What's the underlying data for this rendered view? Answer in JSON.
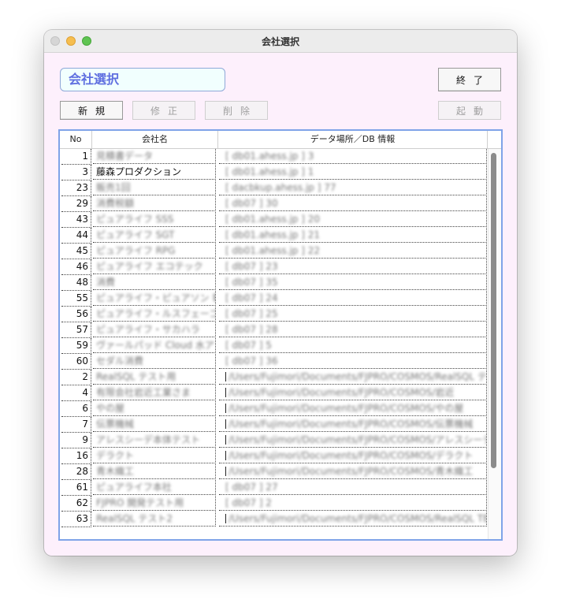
{
  "window": {
    "title": "会社選択"
  },
  "company_field": {
    "value": "会社選択"
  },
  "buttons": {
    "end": "終了",
    "new": "新規",
    "edit": "修正",
    "delete": "削除",
    "launch": "起動"
  },
  "table": {
    "headers": {
      "no": "No",
      "name": "会社名",
      "location": "データ場所／DB 情報"
    },
    "rows": [
      {
        "no": "1",
        "name": "見積書データ",
        "location": "[ db01.ahess.jp ] 3"
      },
      {
        "no": "3",
        "name": "藤森プロダクション",
        "location": "[ db01.ahess.jp ] 1"
      },
      {
        "no": "23",
        "name": "販売1回",
        "location": "[ dacbkup.ahess.jp ] 77"
      },
      {
        "no": "29",
        "name": "消費税額",
        "location": "[ db07 ] 30"
      },
      {
        "no": "43",
        "name": "ピュアライフ SSS",
        "location": "[ db01.ahess.jp ] 20"
      },
      {
        "no": "44",
        "name": "ピュアライフ SGT",
        "location": "[ db01.ahess.jp ] 21"
      },
      {
        "no": "45",
        "name": "ピュアライフ RPG",
        "location": "[ db01.ahess.jp ] 22"
      },
      {
        "no": "46",
        "name": "ピュアライフ エコテック",
        "location": "[ db07 ] 23"
      },
      {
        "no": "48",
        "name": "消費",
        "location": "[ db07 ] 35"
      },
      {
        "no": "55",
        "name": "ピュアライフ・ピュアソン 執",
        "location": "[ db07 ] 24"
      },
      {
        "no": "56",
        "name": "ピュアライフ・ルスフェーゴ",
        "location": "[ db07 ] 25"
      },
      {
        "no": "57",
        "name": "ピュアライフ・サカハラ",
        "location": "[ db07 ] 28"
      },
      {
        "no": "59",
        "name": "ヴァールパッド Cloud 水ア",
        "location": "[ db07 ] 5"
      },
      {
        "no": "60",
        "name": "セダル消費",
        "location": "[ db07 ] 36"
      },
      {
        "no": "2",
        "name": "RealSQL テスト用",
        "location": "/Users/Fujimori/Documents/FJPRO/COSMOS/RealSQL テスト"
      },
      {
        "no": "4",
        "name": "有限会社岩近工業さま",
        "location": "/Users/Fujimori/Documents/FJPRO/COSMOS/岩近"
      },
      {
        "no": "6",
        "name": "やの屋",
        "location": "/Users/Fujimori/Documents/FJPRO/COSMOS/やの屋"
      },
      {
        "no": "7",
        "name": "伝票機械",
        "location": "/Users/Fujimori/Documents/FJPRO/COSMOS/伝票機械"
      },
      {
        "no": "9",
        "name": "アレスシーデ本体テスト",
        "location": "/Users/Fujimori/Documents/FJPRO/COSMOS/アレスシーデ"
      },
      {
        "no": "16",
        "name": "デラクト",
        "location": "/Users/Fujimori/Documents/FJPRO/COSMOS/デラクト"
      },
      {
        "no": "28",
        "name": "青木織工",
        "location": "/Users/Fujimori/Documents/FJPRO/COSMOS/青木織工"
      },
      {
        "no": "61",
        "name": "ピュアライフ本社",
        "location": "[ db07 ] 27"
      },
      {
        "no": "62",
        "name": "FJPRO 開発テスト用",
        "location": "[ db07 ] 2"
      },
      {
        "no": "63",
        "name": "RealSQL テスト2",
        "location": "/Users/Fujimori/Documents/FJPRO/COSMOS/RealSQL TEST"
      }
    ]
  }
}
